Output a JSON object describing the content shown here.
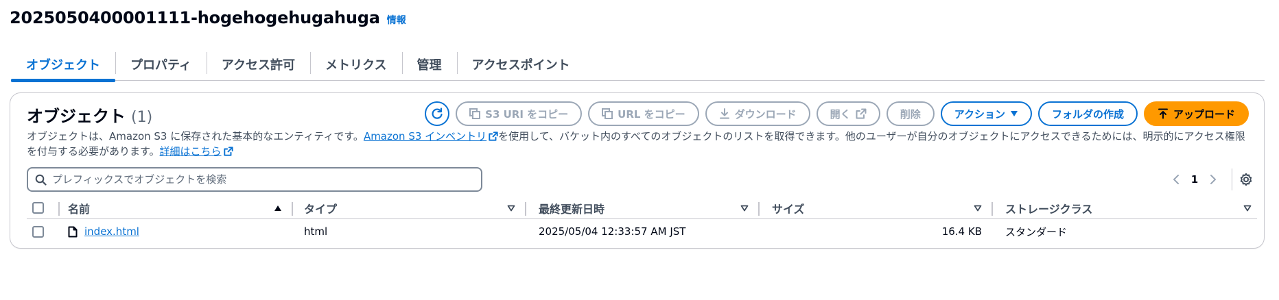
{
  "bucket": {
    "name": "2025050400001111-hogehogehugahuga",
    "info_label": "情報"
  },
  "tabs": [
    {
      "label": "オブジェクト",
      "active": true
    },
    {
      "label": "プロパティ",
      "active": false
    },
    {
      "label": "アクセス許可",
      "active": false
    },
    {
      "label": "メトリクス",
      "active": false
    },
    {
      "label": "管理",
      "active": false
    },
    {
      "label": "アクセスポイント",
      "active": false
    }
  ],
  "objects_panel": {
    "title": "オブジェクト",
    "count": "(1)",
    "description": {
      "part1": "オブジェクトは、Amazon S3 に保存された基本的なエンティティです。",
      "inventory_link": "Amazon S3 インベントリ",
      "part2": "を使用して、バケット内のすべてのオブジェクトのリストを取得できます。他のユーザーが自分のオブジェクトにアクセスできるためには、明示的にアクセス権限を付与する必要があります。",
      "details_link": "詳細はこちら"
    },
    "toolbar": {
      "copy_s3_uri": "S3 URI をコピー",
      "copy_url": "URL をコピー",
      "download": "ダウンロード",
      "open": "開く",
      "delete": "削除",
      "actions": "アクション",
      "create_folder": "フォルダの作成",
      "upload": "アップロード"
    },
    "search": {
      "placeholder": "プレフィックスでオブジェクトを検索",
      "value": ""
    },
    "pagination": {
      "current_page": "1"
    },
    "columns": [
      "名前",
      "タイプ",
      "最終更新日時",
      "サイズ",
      "ストレージクラス"
    ],
    "rows": [
      {
        "name": "index.html",
        "type": "html",
        "last_modified": "2025/05/04 12:33:57 AM JST",
        "size": "16.4 KB",
        "storage_class": "スタンダード"
      }
    ]
  },
  "colors": {
    "link": "#0972d3",
    "primary_button": "#ff9900",
    "disabled": "#9ba7b6",
    "border": "#c6c6cd",
    "heading": "#000716"
  },
  "icons": {
    "refresh": "refresh-icon",
    "copy": "copy-icon",
    "download": "download-icon",
    "external": "external-link-icon",
    "caret": "caret-down-icon",
    "upload": "upload-icon",
    "search": "search-icon",
    "settings": "gear-icon",
    "file": "file-icon"
  }
}
